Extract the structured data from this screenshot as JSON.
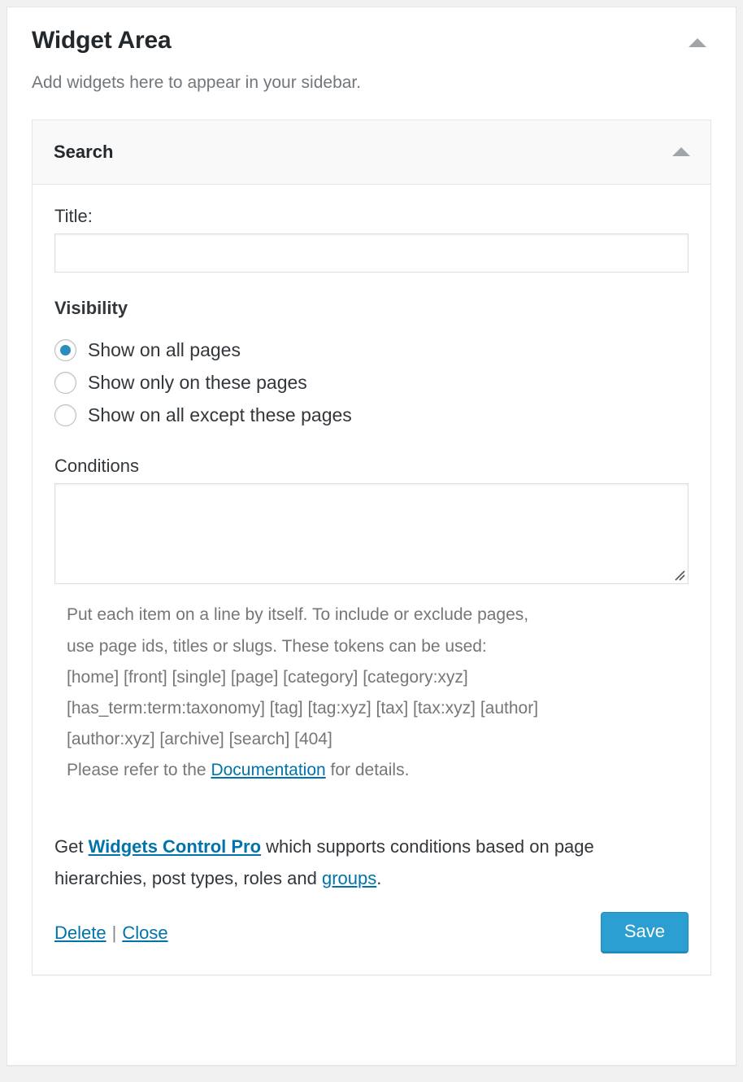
{
  "sidebar": {
    "title": "Widget Area",
    "description": "Add widgets here to appear in your sidebar.",
    "toggle_icon": "triangle-up-icon"
  },
  "widget": {
    "name": "Search",
    "toggle_icon": "triangle-up-icon",
    "title_field": {
      "label": "Title:",
      "value": "",
      "placeholder": ""
    },
    "visibility": {
      "heading": "Visibility",
      "selected": "all",
      "options": [
        {
          "id": "all",
          "label": "Show on all pages",
          "checked": true
        },
        {
          "id": "only",
          "label": "Show only on these pages",
          "checked": false
        },
        {
          "id": "except",
          "label": "Show on all except these pages",
          "checked": false
        }
      ]
    },
    "conditions": {
      "label": "Conditions",
      "value": "",
      "placeholder": "",
      "resize_icon": "resize-grip-icon"
    },
    "help": {
      "line1": "Put each item on a line by itself. To include or exclude pages,",
      "line2": "use page ids, titles or slugs. These tokens can be used:",
      "line3": "[home] [front] [single] [page] [category] [category:xyz]",
      "line4": "[has_term:term:taxonomy] [tag] [tag:xyz] [tax] [tax:xyz] [author]",
      "line5": "[author:xyz] [archive] [search] [404]",
      "doc_prefix": "Please refer to the ",
      "doc_link": "Documentation",
      "doc_suffix": " for details."
    },
    "promo": {
      "prefix": "Get ",
      "product_link": "Widgets Control Pro",
      "middle": " which supports conditions based on page hierarchies, post types, roles and ",
      "groups_link": "groups",
      "suffix": "."
    },
    "footer": {
      "delete_label": "Delete",
      "separator": "|",
      "close_label": "Close",
      "save_label": "Save"
    }
  },
  "colors": {
    "link": "#0073aa",
    "accent": "#2b8cbe",
    "save_button": "#2b9fd1",
    "muted_text": "#767676",
    "panel_header_bg": "#f9f9f9",
    "page_bg": "#f1f1f1"
  }
}
